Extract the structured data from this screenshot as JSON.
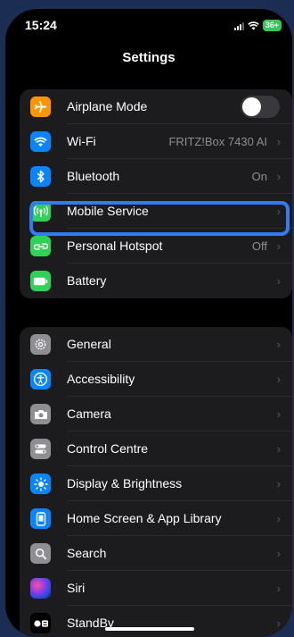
{
  "status": {
    "time": "15:24",
    "battery": "36+"
  },
  "nav": {
    "title": "Settings"
  },
  "group1": [
    {
      "label": "Airplane Mode",
      "icon": "airplane-icon",
      "color": "#ff9500",
      "control": "toggle",
      "toggle_on": false
    },
    {
      "label": "Wi-Fi",
      "detail": "FRITZ!Box 7430 AI",
      "icon": "wifi-icon",
      "color": "#0a84ff"
    },
    {
      "label": "Bluetooth",
      "detail": "On",
      "icon": "bluetooth-icon",
      "color": "#0a84ff"
    },
    {
      "label": "Mobile Service",
      "icon": "antenna-icon",
      "color": "#30d158",
      "highlighted": true
    },
    {
      "label": "Personal Hotspot",
      "detail": "Off",
      "icon": "hotspot-icon",
      "color": "#30d158"
    },
    {
      "label": "Battery",
      "icon": "battery-icon",
      "color": "#30d158"
    }
  ],
  "group2": [
    {
      "label": "General",
      "icon": "gear-icon",
      "color": "#8e8e93"
    },
    {
      "label": "Accessibility",
      "icon": "accessibility-icon",
      "color": "#0a84ff"
    },
    {
      "label": "Camera",
      "icon": "camera-icon",
      "color": "#8e8e93"
    },
    {
      "label": "Control Centre",
      "icon": "control-centre-icon",
      "color": "#8e8e93"
    },
    {
      "label": "Display & Brightness",
      "icon": "sun-icon",
      "color": "#0a84ff"
    },
    {
      "label": "Home Screen & App Library",
      "icon": "home-screen-icon",
      "color": "#0a84ff"
    },
    {
      "label": "Search",
      "icon": "search-icon",
      "color": "#8e8e93"
    },
    {
      "label": "Siri",
      "icon": "siri-icon",
      "color": "#6e4bd8"
    },
    {
      "label": "StandBy",
      "icon": "standby-icon",
      "color": "#1c1c1e"
    }
  ]
}
